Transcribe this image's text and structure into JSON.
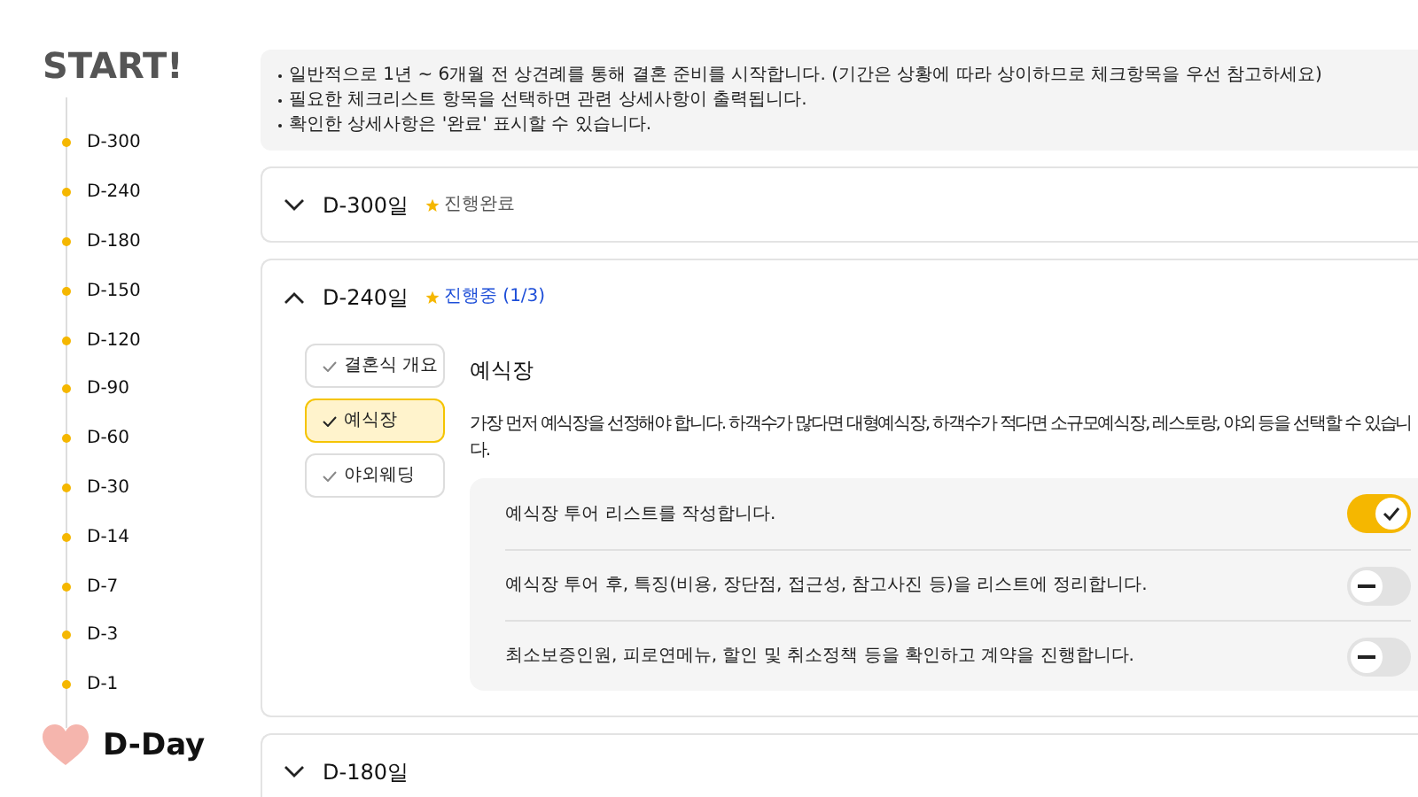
{
  "sidebar": {
    "title": "START!",
    "items": [
      "D-300",
      "D-240",
      "D-180",
      "D-150",
      "D-120",
      "D-90",
      "D-60",
      "D-30",
      "D-14",
      "D-7",
      "D-3",
      "D-1"
    ],
    "end_label": "D-Day"
  },
  "notice": [
    "일반적으로 1년 ~ 6개월 전 상견례를 통해 결혼 준비를 시작합니다. (기간은 상황에 따라 상이하므로 체크항목을 우선 참고하세요)",
    "필요한 체크리스트 항목을 선택하면 관련 상세사항이 출력됩니다.",
    "확인한 상세사항은 '완료' 표시할 수 있습니다."
  ],
  "stages": [
    {
      "title": "D-300일",
      "expanded": false,
      "status": {
        "kind": "done",
        "label": "진행완료"
      }
    },
    {
      "title": "D-240일",
      "expanded": true,
      "status": {
        "kind": "progress",
        "label": "진행중 (1/3)"
      },
      "subitems": [
        {
          "label": "결혼식 개요",
          "selected": false
        },
        {
          "label": "예식장",
          "selected": true
        },
        {
          "label": "야외웨딩",
          "selected": false
        }
      ],
      "detail": {
        "heading": "예식장",
        "description": "가장 먼저 예식장을 선정해야 합니다. 하객수가 많다면 대형예식장, 하객수가 적다면 소규모예식장, 레스토랑, 야외 등을 선택할 수 있습니다.",
        "tasks": [
          {
            "label": "예식장 투어 리스트를 작성합니다.",
            "on": true
          },
          {
            "label": "예식장 투어 후, 특징(비용, 장단점, 접근성, 참고사진 등)을 리스트에 정리합니다.",
            "on": false
          },
          {
            "label": "최소보증인원, 피로연메뉴, 할인 및 취소정책 등을 확인하고 계약을 진행합니다.",
            "on": false
          }
        ]
      }
    },
    {
      "title": "D-180일",
      "expanded": false
    }
  ]
}
